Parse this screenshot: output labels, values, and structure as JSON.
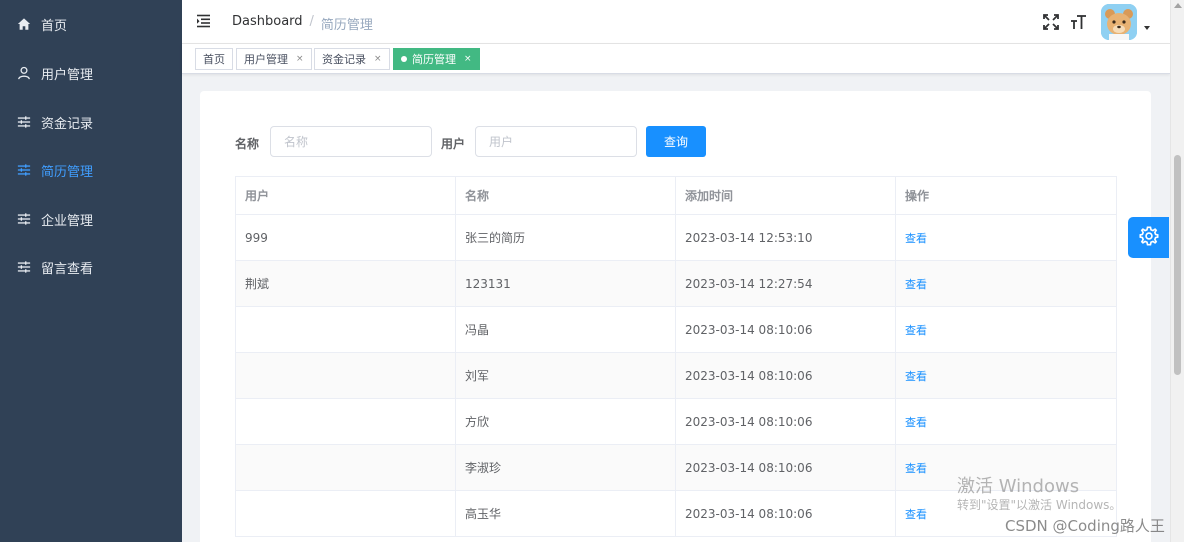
{
  "sidebar": {
    "items": [
      {
        "label": "首页",
        "icon": "home-icon"
      },
      {
        "label": "用户管理",
        "icon": "user-icon"
      },
      {
        "label": "资金记录",
        "icon": "sliders-icon"
      },
      {
        "label": "简历管理",
        "icon": "sliders-icon",
        "active": true
      },
      {
        "label": "企业管理",
        "icon": "sliders-icon"
      },
      {
        "label": "留言查看",
        "icon": "sliders-icon"
      }
    ]
  },
  "header": {
    "breadcrumb": {
      "home": "Dashboard",
      "separator": "/",
      "current": "简历管理"
    }
  },
  "tags": [
    {
      "label": "首页"
    },
    {
      "label": "用户管理",
      "close": "×"
    },
    {
      "label": "资金记录",
      "close": "×"
    },
    {
      "label": "简历管理",
      "close": "×",
      "active": true
    }
  ],
  "search": {
    "name_label": "名称",
    "name_placeholder": "名称",
    "user_label": "用户",
    "user_placeholder": "用户",
    "query_button": "查询"
  },
  "table": {
    "headers": [
      "用户",
      "名称",
      "添加时间",
      "操作"
    ],
    "rows": [
      {
        "user": "999",
        "name": "张三的简历",
        "time": "2023-03-14 12:53:10",
        "action": "查看"
      },
      {
        "user": "荆斌",
        "name": "123131",
        "time": "2023-03-14 12:27:54",
        "action": "查看"
      },
      {
        "user": "",
        "name": "冯晶",
        "time": "2023-03-14 08:10:06",
        "action": "查看"
      },
      {
        "user": "",
        "name": "刘军",
        "time": "2023-03-14 08:10:06",
        "action": "查看"
      },
      {
        "user": "",
        "name": "方欣",
        "time": "2023-03-14 08:10:06",
        "action": "查看"
      },
      {
        "user": "",
        "name": "李淑珍",
        "time": "2023-03-14 08:10:06",
        "action": "查看"
      },
      {
        "user": "",
        "name": "高玉华",
        "time": "2023-03-14 08:10:06",
        "action": "查看"
      }
    ]
  },
  "watermark": {
    "line1": "激活 Windows",
    "line2": "转到\"设置\"以激活 Windows。",
    "csdn": "CSDN @Coding路人王"
  },
  "colors": {
    "sidebar_bg": "#304156",
    "active_menu": "#409eff",
    "tag_active": "#42b983",
    "primary": "#1890ff"
  }
}
